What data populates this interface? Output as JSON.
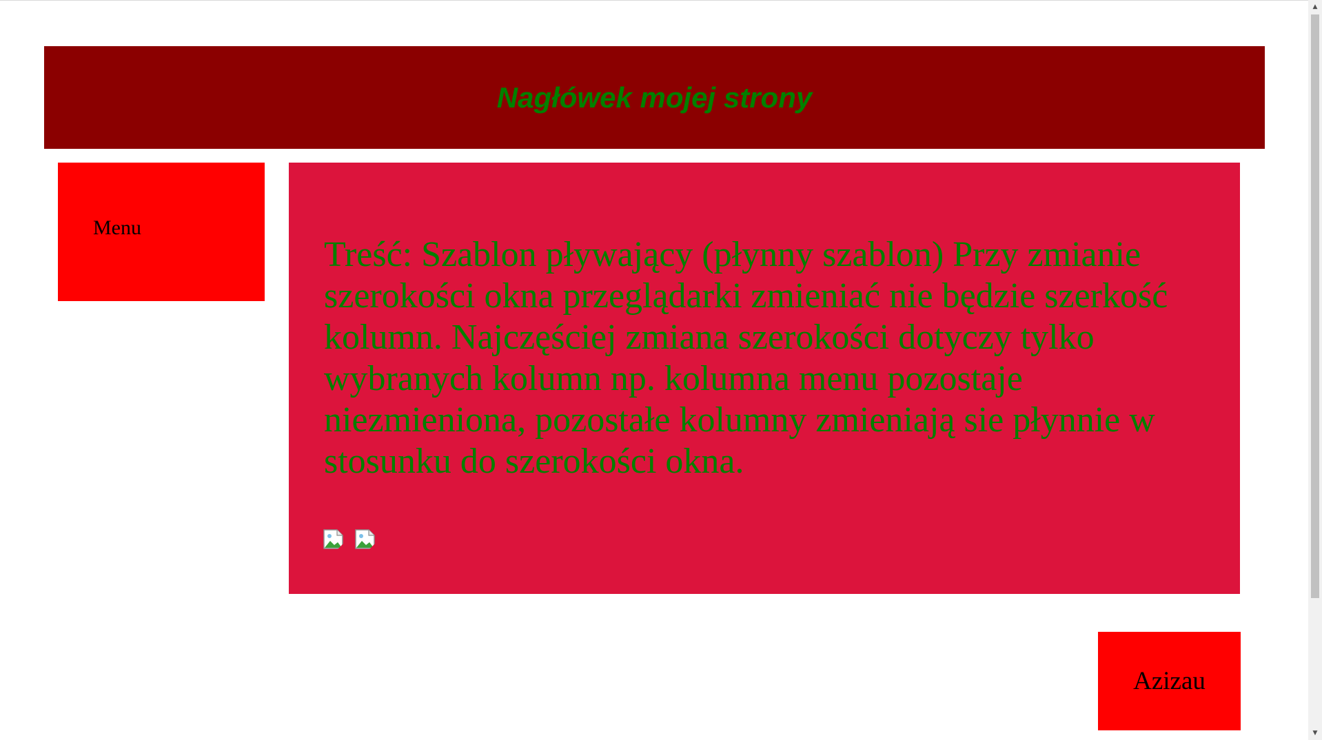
{
  "header": {
    "title": "Nagłówek mojej strony"
  },
  "menu": {
    "label": "Menu"
  },
  "content": {
    "text": "Treść: Szablon pływający (płynny szablon) Przy zmianie szerokości okna przeglądarki zmieniać nie będzie szerkość kolumn. Najczęściej zmiana szerokości dotyczy tylko wybranych kolumn np. kolumna menu pozostaje niezmieniona, pozostałe kolumny zmieniają sie płynnie w stosunku do szerokości okna.",
    "images": [
      {
        "icon": "broken-image-icon"
      },
      {
        "icon": "broken-image-icon"
      }
    ]
  },
  "footer": {
    "label": "Azizau"
  },
  "colors": {
    "header_bg": "#8b0000",
    "header_text": "#008000",
    "menu_bg": "#ff0000",
    "content_bg": "#dc143c",
    "content_text": "#008000",
    "footer_bg": "#ff0000"
  }
}
